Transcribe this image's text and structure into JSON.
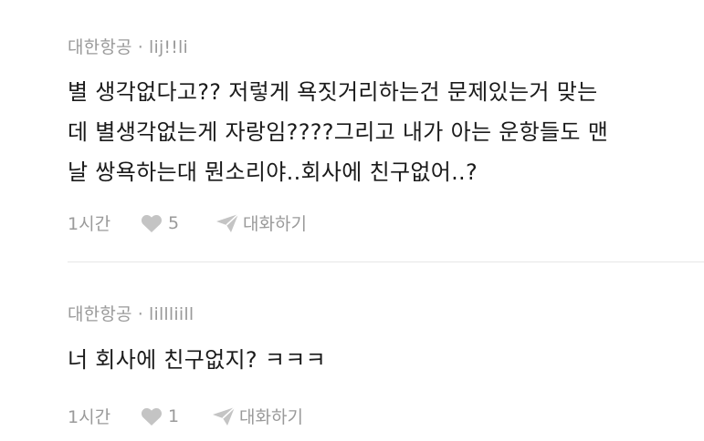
{
  "comments": [
    {
      "company": "대한항공",
      "separator": "·",
      "username": "lij!!li",
      "lines": [
        "별 생각없다고?? 저렇게 욕짓거리하는건 문제있는거 맞는",
        "데 별생각없는게 자랑임????그리고 내가 아는 운항들도 맨",
        "날 쌍욕하는대 뭔소리야..회사에 친구없어..?"
      ],
      "time": "1시간",
      "likes": "5",
      "reply_label": "대화하기"
    },
    {
      "company": "대한항공",
      "separator": "·",
      "username": "lillliill",
      "lines": [
        "너 회사에 친구없지? ㅋㅋㅋ"
      ],
      "time": "1시간",
      "likes": "1",
      "reply_label": "대화하기"
    }
  ],
  "colors": {
    "meta": "#9a9a9a",
    "text": "#1a1a1a",
    "divider": "#e6e6e6",
    "icon": "#c4c4c4"
  },
  "icons": {
    "like": "heart-icon",
    "reply": "paper-plane-icon"
  }
}
